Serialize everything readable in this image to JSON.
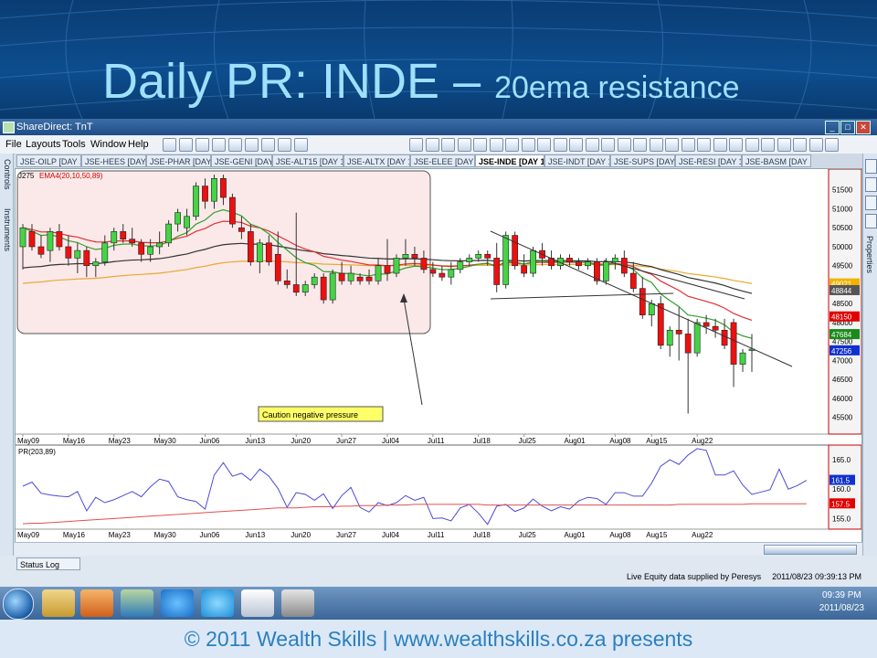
{
  "slide": {
    "title_main": "Daily PR: INDE – ",
    "title_sub": "20ema resistance",
    "footer": "© 2011 Wealth Skills | www.wealthskills.co.za presents"
  },
  "app": {
    "window_title": "ShareDirect: TnT",
    "menus": [
      "File",
      "Layouts",
      "Tools",
      "Window",
      "Help"
    ],
    "left_tabs": [
      "Controls",
      "Instruments"
    ],
    "right_tabs": [
      "Properties"
    ],
    "chart_tabs": [
      "JSE-OILP [DAY 1]",
      "JSE-HEES [DAY 1]",
      "JSE-PHAR [DAY 1]",
      "JSE-GENI [DAY 1]",
      "JSE-ALT15 [DAY 1]",
      "JSE-ALTX [DAY 1]",
      "JSE-ELEE [DAY 1]",
      "JSE-INDE [DAY 1]",
      "JSE-INDT [DAY 1]",
      "JSE-SUPS [DAY 1]",
      "JSE-RESI [DAY 1]",
      "JSE-BASM [DAY 1]"
    ],
    "active_tab": 7,
    "status_log": "Status Log",
    "data_source": "Live Equity data supplied by Peresys",
    "data_time": "2011/08/23 09:39:13 PM",
    "clock_time": "09:39 PM",
    "clock_date": "2011/08/23"
  },
  "chart_data": [
    {
      "type": "candlestick",
      "label": "J275",
      "indicator": "EMA4(20,10,50,89)",
      "ylim": [
        45300,
        52000
      ],
      "yticks": [
        45500,
        46000,
        46500,
        47000,
        47500,
        48000,
        48500,
        49000,
        49500,
        50000,
        50500,
        51000,
        51500
      ],
      "x_labels": [
        "May09",
        "May16",
        "May23",
        "May30",
        "Jun06",
        "Jun13",
        "Jun20",
        "Jun27",
        "Jul04",
        "Jul11",
        "Jul18",
        "Jul25",
        "Aug01",
        "Aug08",
        "Aug15",
        "Aug22"
      ],
      "price_markers": [
        {
          "value": 49021,
          "color": "#f0b400"
        },
        {
          "value": 48844,
          "color": "#555555"
        },
        {
          "value": 48150,
          "color": "#e00000"
        },
        {
          "value": 47684,
          "color": "#1a8a1a"
        },
        {
          "value": 47256,
          "color": "#1030d0"
        }
      ],
      "annotation": "Caution negative pressure",
      "candles": [
        {
          "o": 50000,
          "h": 50600,
          "l": 49400,
          "c": 50500
        },
        {
          "o": 50400,
          "h": 50600,
          "l": 49900,
          "c": 50000
        },
        {
          "o": 50000,
          "h": 50300,
          "l": 49700,
          "c": 49800
        },
        {
          "o": 49900,
          "h": 50500,
          "l": 49600,
          "c": 50400
        },
        {
          "o": 50400,
          "h": 50600,
          "l": 49900,
          "c": 50000
        },
        {
          "o": 50000,
          "h": 50300,
          "l": 49500,
          "c": 49700
        },
        {
          "o": 49700,
          "h": 50100,
          "l": 49300,
          "c": 49900
        },
        {
          "o": 49900,
          "h": 50000,
          "l": 49200,
          "c": 49500
        },
        {
          "o": 49500,
          "h": 49700,
          "l": 49200,
          "c": 49600
        },
        {
          "o": 49600,
          "h": 50300,
          "l": 49500,
          "c": 50100
        },
        {
          "o": 50100,
          "h": 50500,
          "l": 49900,
          "c": 50400
        },
        {
          "o": 50400,
          "h": 50600,
          "l": 50100,
          "c": 50200
        },
        {
          "o": 50200,
          "h": 50500,
          "l": 50000,
          "c": 50100
        },
        {
          "o": 50100,
          "h": 50200,
          "l": 49600,
          "c": 49800
        },
        {
          "o": 49800,
          "h": 50200,
          "l": 49600,
          "c": 50000
        },
        {
          "o": 50000,
          "h": 50400,
          "l": 49800,
          "c": 50100
        },
        {
          "o": 50100,
          "h": 50700,
          "l": 50000,
          "c": 50600
        },
        {
          "o": 50600,
          "h": 51000,
          "l": 50400,
          "c": 50900
        },
        {
          "o": 50500,
          "h": 51000,
          "l": 50300,
          "c": 50800
        },
        {
          "o": 50800,
          "h": 51700,
          "l": 50700,
          "c": 51600
        },
        {
          "o": 51600,
          "h": 51800,
          "l": 51000,
          "c": 51200
        },
        {
          "o": 51200,
          "h": 51900,
          "l": 51000,
          "c": 51800
        },
        {
          "o": 51800,
          "h": 51900,
          "l": 51100,
          "c": 51300
        },
        {
          "o": 51300,
          "h": 51400,
          "l": 50500,
          "c": 50600
        },
        {
          "o": 50500,
          "h": 50800,
          "l": 50200,
          "c": 50400
        },
        {
          "o": 50400,
          "h": 50600,
          "l": 49500,
          "c": 49600
        },
        {
          "o": 49600,
          "h": 50200,
          "l": 49300,
          "c": 50100
        },
        {
          "o": 50100,
          "h": 50300,
          "l": 49500,
          "c": 49600
        },
        {
          "o": 49800,
          "h": 50400,
          "l": 49000,
          "c": 49100
        },
        {
          "o": 49100,
          "h": 49400,
          "l": 48900,
          "c": 49000
        },
        {
          "o": 49000,
          "h": 50900,
          "l": 48700,
          "c": 48800
        },
        {
          "o": 48800,
          "h": 49100,
          "l": 48700,
          "c": 49000
        },
        {
          "o": 49000,
          "h": 49300,
          "l": 48900,
          "c": 49200
        },
        {
          "o": 49200,
          "h": 49300,
          "l": 48500,
          "c": 48600
        },
        {
          "o": 48600,
          "h": 49400,
          "l": 48500,
          "c": 49300
        },
        {
          "o": 49300,
          "h": 49600,
          "l": 49000,
          "c": 49100
        },
        {
          "o": 49100,
          "h": 49500,
          "l": 49000,
          "c": 49300
        },
        {
          "o": 49200,
          "h": 49300,
          "l": 49000,
          "c": 49100
        },
        {
          "o": 49200,
          "h": 49400,
          "l": 49000,
          "c": 49100
        },
        {
          "o": 49100,
          "h": 49700,
          "l": 49000,
          "c": 49500
        },
        {
          "o": 49500,
          "h": 50200,
          "l": 49100,
          "c": 49300
        },
        {
          "o": 49300,
          "h": 49800,
          "l": 49200,
          "c": 49700
        },
        {
          "o": 49700,
          "h": 50200,
          "l": 49500,
          "c": 49800
        },
        {
          "o": 49800,
          "h": 50000,
          "l": 49500,
          "c": 49700
        },
        {
          "o": 49700,
          "h": 49900,
          "l": 49300,
          "c": 49400
        },
        {
          "o": 49400,
          "h": 49600,
          "l": 49200,
          "c": 49300
        },
        {
          "o": 49300,
          "h": 49500,
          "l": 49100,
          "c": 49200
        },
        {
          "o": 49200,
          "h": 49600,
          "l": 49000,
          "c": 49400
        },
        {
          "o": 49400,
          "h": 49700,
          "l": 49300,
          "c": 49600
        },
        {
          "o": 49600,
          "h": 49800,
          "l": 49500,
          "c": 49700
        },
        {
          "o": 49700,
          "h": 49900,
          "l": 49600,
          "c": 49800
        },
        {
          "o": 49800,
          "h": 49900,
          "l": 49500,
          "c": 49700
        },
        {
          "o": 49700,
          "h": 50100,
          "l": 48800,
          "c": 49000
        },
        {
          "o": 49000,
          "h": 50400,
          "l": 48900,
          "c": 50300
        },
        {
          "o": 50300,
          "h": 50400,
          "l": 49400,
          "c": 49500
        },
        {
          "o": 49500,
          "h": 49800,
          "l": 49200,
          "c": 49300
        },
        {
          "o": 49300,
          "h": 50000,
          "l": 49200,
          "c": 49900
        },
        {
          "o": 49900,
          "h": 50100,
          "l": 49500,
          "c": 49700
        },
        {
          "o": 49700,
          "h": 49900,
          "l": 49400,
          "c": 49500
        },
        {
          "o": 49500,
          "h": 49800,
          "l": 49400,
          "c": 49700
        },
        {
          "o": 49700,
          "h": 49800,
          "l": 49500,
          "c": 49600
        },
        {
          "o": 49600,
          "h": 49700,
          "l": 49400,
          "c": 49500
        },
        {
          "o": 49500,
          "h": 49700,
          "l": 49400,
          "c": 49600
        },
        {
          "o": 49600,
          "h": 49700,
          "l": 49000,
          "c": 49100
        },
        {
          "o": 49100,
          "h": 49700,
          "l": 49000,
          "c": 49600
        },
        {
          "o": 49600,
          "h": 49800,
          "l": 49400,
          "c": 49700
        },
        {
          "o": 49700,
          "h": 49900,
          "l": 49200,
          "c": 49300
        },
        {
          "o": 49300,
          "h": 49600,
          "l": 48800,
          "c": 48900
        },
        {
          "o": 48900,
          "h": 49200,
          "l": 48100,
          "c": 48200
        },
        {
          "o": 48200,
          "h": 48600,
          "l": 47900,
          "c": 48500
        },
        {
          "o": 48500,
          "h": 48700,
          "l": 47300,
          "c": 47400
        },
        {
          "o": 47400,
          "h": 47900,
          "l": 47100,
          "c": 47800
        },
        {
          "o": 47800,
          "h": 48400,
          "l": 47000,
          "c": 47700
        },
        {
          "o": 47700,
          "h": 48100,
          "l": 45600,
          "c": 47200
        },
        {
          "o": 47200,
          "h": 48100,
          "l": 47100,
          "c": 48000
        },
        {
          "o": 48000,
          "h": 48200,
          "l": 47700,
          "c": 47900
        },
        {
          "o": 47900,
          "h": 48100,
          "l": 47600,
          "c": 47800
        },
        {
          "o": 47800,
          "h": 48100,
          "l": 47300,
          "c": 47400
        },
        {
          "o": 48000,
          "h": 48100,
          "l": 46300,
          "c": 46900
        },
        {
          "o": 46900,
          "h": 47300,
          "l": 46700,
          "c": 47200
        },
        {
          "o": 47300,
          "h": 47700,
          "l": 46700,
          "c": 47300
        }
      ]
    },
    {
      "type": "line",
      "label": "PR(203,89)",
      "ylim": [
        153.5,
        167.5
      ],
      "yticks": [
        155.0,
        160.0,
        165.0
      ],
      "value_markers": [
        {
          "value": 161.5,
          "color": "#1030d0"
        },
        {
          "value": 157.5,
          "color": "#e00000"
        }
      ],
      "x_labels": [
        "May09",
        "May16",
        "May23",
        "May30",
        "Jun06",
        "Jun13",
        "Jun20",
        "Jun27",
        "Jul04",
        "Jul11",
        "Jul18",
        "Jul25",
        "Aug01",
        "Aug08",
        "Aug15",
        "Aug22"
      ],
      "series": [
        {
          "color": "#4a4ad8",
          "values": [
            160.5,
            161.2,
            159.3,
            159.0,
            158.8,
            158.7,
            159.6,
            156.3,
            158.6,
            157.7,
            158.2,
            158.9,
            159.6,
            158.7,
            160.4,
            161.7,
            161.3,
            158.7,
            158.2,
            157.9,
            156.6,
            162.4,
            164.5,
            162.2,
            162.7,
            161.5,
            163.4,
            162.2,
            160.1,
            156.9,
            159.4,
            159.1,
            158.1,
            159.2,
            156.7,
            158.9,
            160.3,
            156.9,
            156.1,
            157.7,
            157.2,
            157.7,
            158.9,
            158.1,
            158.6,
            155.0,
            155.1,
            154.6,
            156.8,
            157.4,
            155.9,
            154.0,
            157.1,
            157.4,
            156.2,
            156.8,
            158.3,
            157.1,
            156.3,
            157.0,
            156.6,
            158.0,
            158.6,
            158.4,
            157.4,
            159.4,
            159.4,
            158.8,
            158.8,
            161.0,
            163.9,
            165.0,
            164.2,
            165.8,
            166.9,
            166.6,
            162.4,
            162.4,
            163.1,
            160.7,
            159.1,
            159.5,
            159.9,
            163.4,
            160.0,
            160.6,
            161.5
          ]
        },
        {
          "color": "#e05050",
          "values": [
            154.1,
            154.2,
            154.2,
            154.3,
            154.4,
            154.5,
            154.6,
            154.7,
            154.8,
            154.9,
            155.0,
            155.1,
            155.2,
            155.3,
            155.4,
            155.5,
            155.6,
            155.7,
            155.8,
            155.9,
            156.0,
            156.1,
            156.2,
            156.3,
            156.4,
            156.5,
            156.6,
            156.7,
            156.8,
            156.8,
            156.8,
            156.9,
            157.0,
            157.0,
            157.0,
            157.1,
            157.1,
            157.2,
            157.2,
            157.2,
            157.3,
            157.3,
            157.3,
            157.4,
            157.4,
            157.4,
            157.4,
            157.4,
            157.4,
            157.4,
            157.4,
            157.3,
            157.3,
            157.3,
            157.3,
            157.3,
            157.3,
            157.3,
            157.3,
            157.3,
            157.3,
            157.3,
            157.3,
            157.3,
            157.3,
            157.3,
            157.3,
            157.3,
            157.3,
            157.3,
            157.3,
            157.3,
            157.4,
            157.4,
            157.4,
            157.4,
            157.4,
            157.4,
            157.4,
            157.4,
            157.5,
            157.5,
            157.5,
            157.5,
            157.5,
            157.5,
            157.5
          ]
        }
      ]
    }
  ]
}
